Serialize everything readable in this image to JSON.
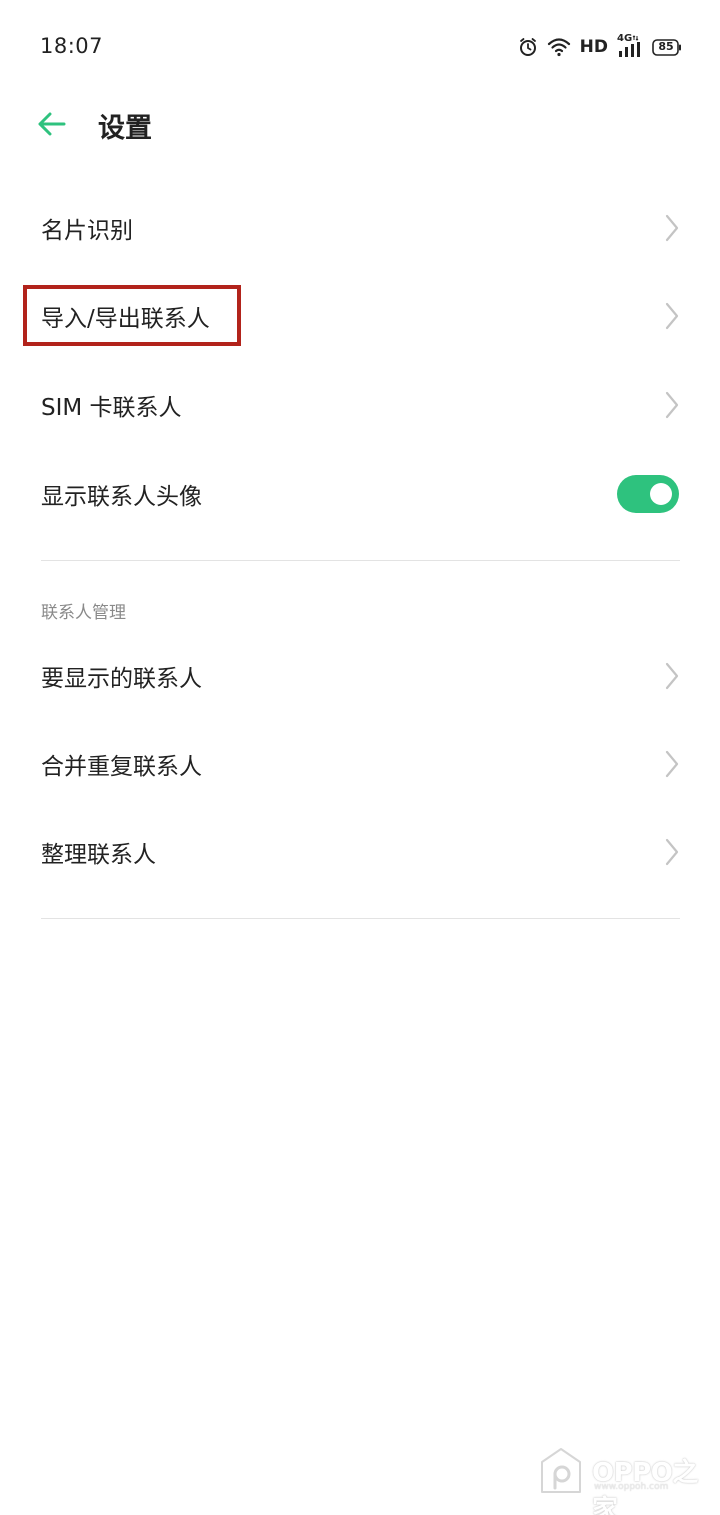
{
  "status_bar": {
    "time": "18:07",
    "hd": "HD",
    "network": "4G",
    "battery": "85"
  },
  "header": {
    "title": "设置"
  },
  "settings": {
    "items": [
      {
        "label": "名片识别"
      },
      {
        "label": "导入/导出联系人"
      },
      {
        "label": "SIM 卡联系人"
      },
      {
        "label": "显示联系人头像",
        "toggle_on": true
      }
    ]
  },
  "contact_management": {
    "section_title": "联系人管理",
    "items": [
      {
        "label": "要显示的联系人"
      },
      {
        "label": "合并重复联系人"
      },
      {
        "label": "整理联系人"
      }
    ]
  },
  "watermark": {
    "text": "OPPO之家",
    "sub": "www.oppoh.com"
  },
  "colors": {
    "accent": "#2ec27e",
    "highlight": "#b2231b"
  }
}
